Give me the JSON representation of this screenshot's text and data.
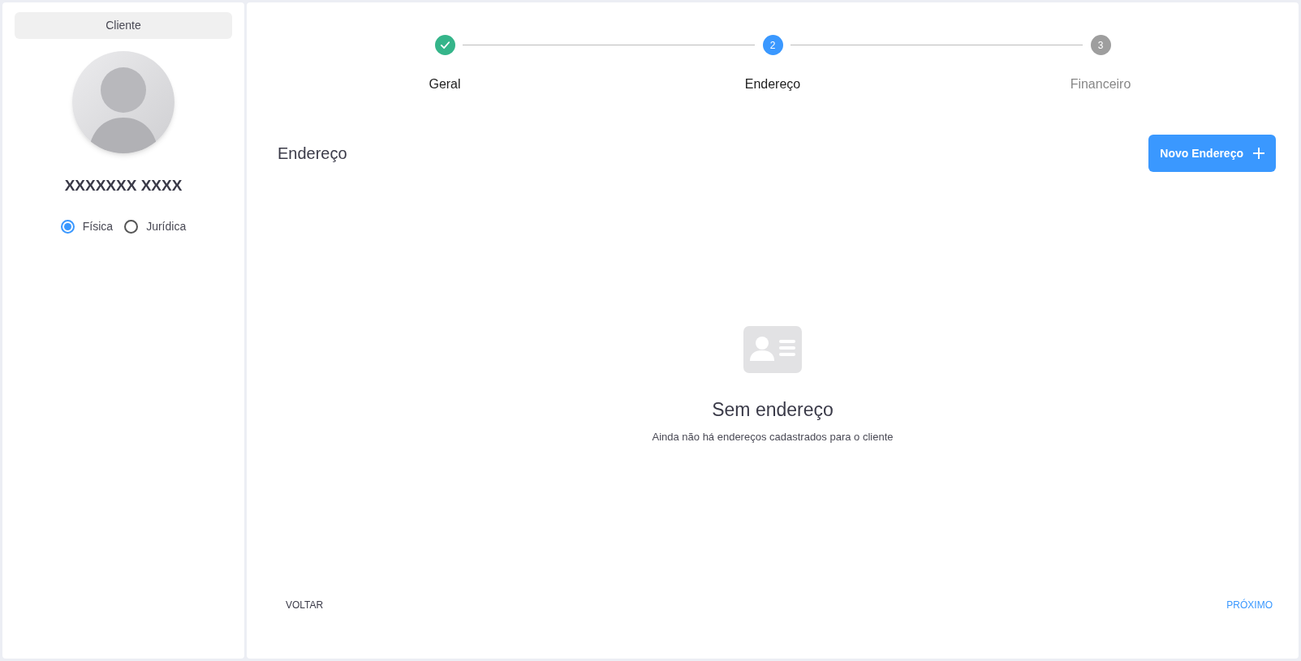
{
  "sidebar": {
    "title": "Cliente",
    "name": "XXXXXXX XXXX",
    "person_types": [
      {
        "label": "Física",
        "selected": true
      },
      {
        "label": "Jurídica",
        "selected": false
      }
    ]
  },
  "stepper": [
    {
      "label": "Geral",
      "kind": "done"
    },
    {
      "label": "Endereço",
      "marker": "2",
      "kind": "current"
    },
    {
      "label": "Financeiro",
      "marker": "3",
      "kind": "pending"
    }
  ],
  "section": {
    "title": "Endereço",
    "add_button": "Novo Endereço"
  },
  "empty_state": {
    "title": "Sem endereço",
    "message": "Ainda não há endereços cadastrados para o cliente"
  },
  "footer": {
    "back": "VOLTAR",
    "next": "PRÓXIMO"
  }
}
